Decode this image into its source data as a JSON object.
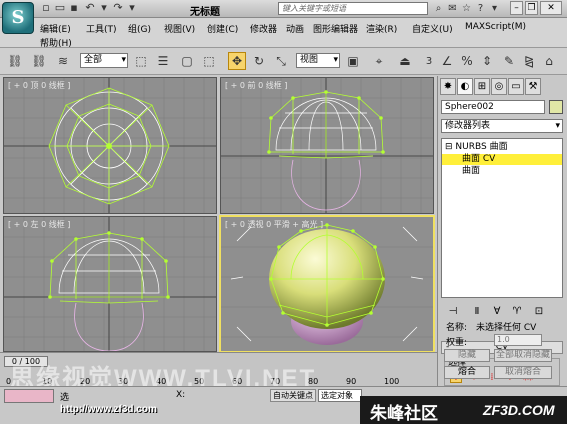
{
  "titlebar": {
    "title": "无标题",
    "search_placeholder": "键入关键字或短语",
    "app_icon_letter": "S"
  },
  "menu": [
    "编辑(E)",
    "工具(T)",
    "组(G)",
    "视图(V)",
    "创建(C)",
    "修改器",
    "动画",
    "图形编辑器",
    "渲染(R)",
    "自定义(U)",
    "MAXScript(M)",
    "帮助(H)"
  ],
  "toolbar": {
    "selection_filter": "全部",
    "reference_coord": "视图",
    "snap_count": "3"
  },
  "viewports": [
    {
      "label": "[ + 0 顶 0 线框 ]"
    },
    {
      "label": "[ + 0 前 0 线框 ]"
    },
    {
      "label": "[ + 0 左 0 线框 ]"
    },
    {
      "label": "[ + 0 透视 0 平滑 + 高光 ]"
    }
  ],
  "command_panel": {
    "object_name": "Sphere002",
    "object_color": "#e1e7a6",
    "modifier_list": "修改器列表",
    "stack": [
      {
        "label": "NURBS 曲面",
        "level": 0,
        "selected": false
      },
      {
        "label": "曲面 CV",
        "level": 1,
        "selected": true
      },
      {
        "label": "曲面",
        "level": 1,
        "selected": false
      }
    ],
    "rollout_title": "CV",
    "selection_label": "选择",
    "name_label": "名称:",
    "name_value": "未选择任何 CV",
    "weight_label": "权重:",
    "weight_value": "1.0",
    "hide_button": "隐藏",
    "unhide_all_button": "全部取消隐藏",
    "fuse_button": "熔合",
    "unfuse_button": "取消熔合"
  },
  "timeline": {
    "frame_display": "0 / 100",
    "ticks": [
      "0",
      "10",
      "20",
      "30",
      "40",
      "50",
      "60",
      "70",
      "80",
      "90",
      "100"
    ]
  },
  "statusbar": {
    "selection_lock_label": "选",
    "x_label": "X:",
    "auto_key": "自动关键点",
    "set_key_filter": "选定对象"
  },
  "watermark": {
    "url": "http://www.zf3d.com",
    "site_cn": "朱峰社区",
    "site_en": "ZF3D.COM",
    "overlay": "思缘视觉WWW.TLVI.NET"
  }
}
